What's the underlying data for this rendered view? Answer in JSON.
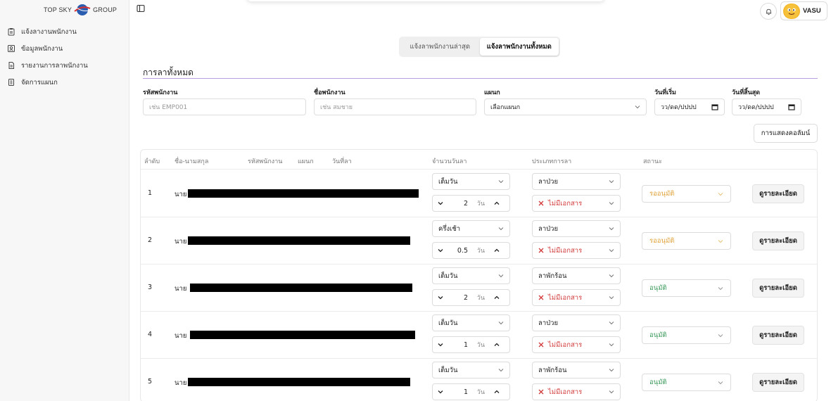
{
  "sidebar": {
    "logo_text_left": "TOP SKY",
    "logo_text_right": "GROUP",
    "items": [
      {
        "label": "แจ้งลางานพนักงาน",
        "icon": "clipboard-icon"
      },
      {
        "label": "ข้อมูลพนักงาน",
        "icon": "id-card-icon"
      },
      {
        "label": "รายงานการลาพนักงาน",
        "icon": "document-icon"
      },
      {
        "label": "จัดการแผนก",
        "icon": "building-icon"
      }
    ]
  },
  "header": {
    "user_name": "VASU"
  },
  "tabs": [
    {
      "label": "แจ้งลาพนักงานล่าสุด",
      "active": false
    },
    {
      "label": "แจ้งลาพนักงานทั้งหมด",
      "active": true
    }
  ],
  "section_title": "การลาทั้งหมด",
  "filters": {
    "emp_code_label": "รหัสพนักงาน",
    "emp_code_placeholder": "เช่น EMP001",
    "emp_name_label": "ชื่อพนักงาน",
    "emp_name_placeholder": "เช่น สมชาย",
    "dept_label": "แผนก",
    "dept_value": "เลือกแผนก",
    "start_label": "วันที่เริ่ม",
    "start_value": "วว/ดด/ปปปป",
    "end_label": "วันที่สิ้นสุด",
    "end_value": "วว/ดด/ปปปป"
  },
  "columns_button": "การแสดงคอลัมน์",
  "table": {
    "headers": {
      "no": "ลำดับ",
      "name": "ชื่อ-นามสกุล",
      "code": "รหัสพนักงาน",
      "dept": "แผนก",
      "date": "วันที่ลา",
      "amount": "จำนวนวันลา",
      "type": "ประเภทการลา",
      "status": "สถานะ"
    },
    "unit": "วัน",
    "no_doc_label": "ไม่มีเอกสาร",
    "detail_label": "ดูรายละเอียด",
    "rows": [
      {
        "no": "1",
        "prefix": "นาย",
        "duration": "เต็มวัน",
        "days": "2",
        "type": "ลาป่วย",
        "status": "รออนุมัติ"
      },
      {
        "no": "2",
        "prefix": "นาย",
        "duration": "ครึ่งเช้า",
        "days": "0.5",
        "type": "ลาป่วย",
        "status": "รออนุมัติ"
      },
      {
        "no": "3",
        "prefix": "นาย",
        "duration": "เต็มวัน",
        "days": "2",
        "type": "ลาพักร้อน",
        "status": "อนุมัติ"
      },
      {
        "no": "4",
        "prefix": "นาย",
        "duration": "เต็มวัน",
        "days": "1",
        "type": "ลาป่วย",
        "status": "อนุมัติ"
      },
      {
        "no": "5",
        "prefix": "นาย",
        "duration": "เต็มวัน",
        "days": "1",
        "type": "ลาพักร้อน",
        "status": "อนุมัติ"
      }
    ]
  },
  "colors": {
    "pending": "#e0a33a",
    "approved": "#3a9a5b",
    "no_doc": "#d23a3a",
    "accent_rule": "#b99ee0"
  }
}
